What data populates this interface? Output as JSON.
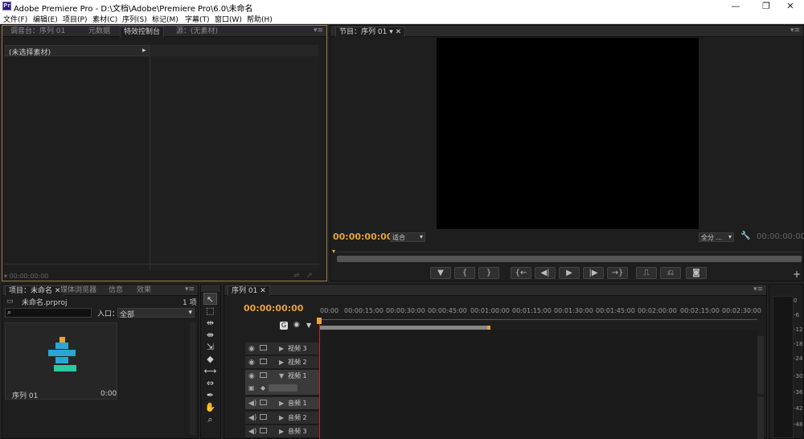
{
  "window": {
    "title": "Adobe Premiere Pro - D:\\文档\\Adobe\\Premiere Pro\\6.0\\未命名",
    "app_icon": "Pr",
    "controls": [
      "—",
      "❐",
      "✕"
    ]
  },
  "menu": [
    "文件(F)",
    "编辑(E)",
    "项目(P)",
    "素材(C)",
    "序列(S)",
    "标记(M)",
    "字幕(T)",
    "窗口(W)",
    "帮助(H)"
  ],
  "source_panel": {
    "tabs": [
      "调音台：序列 01",
      "元数据",
      "特效控制台",
      "源：(无素材)"
    ],
    "active_tab": 2,
    "no_clip_label": "(未选择素材)",
    "timecode": "00:00:00:00"
  },
  "program_monitor": {
    "tab": "节目：序列 01",
    "timecode": "00:00:00:00",
    "fit": "适合",
    "quality": "全分 ...",
    "duration": "00:00:00:00"
  },
  "project_panel": {
    "tabs": [
      "项目：未命名",
      "媒体浏览器",
      "信息",
      "效果"
    ],
    "project_file": "未命名.prproj",
    "item_count": "1 项",
    "search_placeholder": "",
    "in_label": "入口：",
    "in_value": "全部",
    "sequence_name": "序列 01",
    "sequence_duration": "0:00"
  },
  "timeline": {
    "tab": "序列 01",
    "timecode": "00:00:00:00",
    "ruler": [
      "00:00",
      "00:00:15:00",
      "00:00:30:00",
      "00:00:45:00",
      "00:01:00:00",
      "00:01:15:00",
      "00:01:30:00",
      "00:01:45:00",
      "00:02:00:00",
      "00:02:15:00",
      "00:02:30:00"
    ],
    "video_tracks": [
      "视频 3",
      "视频 2",
      "视频 1"
    ],
    "audio_tracks": [
      "音频 1",
      "音频 2",
      "音频 3"
    ]
  },
  "meter_labels": [
    "0",
    "-6",
    "-12",
    "-18",
    "-24",
    "-30",
    "-36",
    "-42",
    "-48"
  ],
  "colors": {
    "accent": "#e8a33b",
    "highlight_border": "#9a7a44",
    "playhead": "#d02020"
  }
}
